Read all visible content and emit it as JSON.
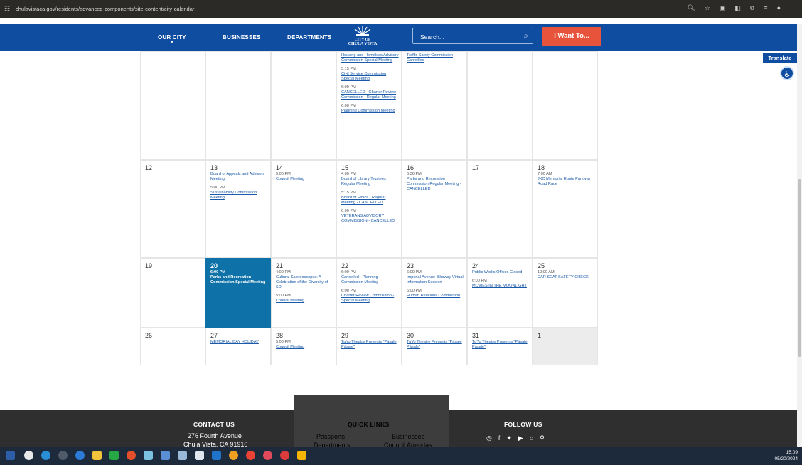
{
  "browser": {
    "url": "chulavistaca.gov/residents/advanced-components/site-content/city-calendar"
  },
  "nav": {
    "our_city": "OUR CITY",
    "businesses": "BUSINESSES",
    "departments": "DEPARTMENTS",
    "logo_line1": "CITY OF",
    "logo_line2": "CHULA VISTA",
    "search_placeholder": "Search...",
    "i_want_to": "I Want To..."
  },
  "translate_label": "Translate",
  "calendar": {
    "first_row": [
      {
        "day": "",
        "events": []
      },
      {
        "day": "",
        "events": []
      },
      {
        "day": "",
        "events": []
      },
      {
        "day": "",
        "events": [
          {
            "time": "",
            "title": "Housing and Homeless Advisory Commission Special Meeting"
          },
          {
            "time": "5:15 PM",
            "title": "Civil Service Commission Special Meeting"
          },
          {
            "time": "6:00 PM",
            "title": "CANCELLED - Charter Review Commission - Regular Meeting"
          },
          {
            "time": "6:00 PM",
            "title": "Planning Commission Meeting"
          }
        ]
      },
      {
        "day": "",
        "events": [
          {
            "time": "",
            "title": "Traffic Safety Commission Cancelled"
          }
        ]
      },
      {
        "day": "",
        "events": []
      },
      {
        "day": "",
        "events": []
      }
    ],
    "week2": [
      {
        "day": "12",
        "events": []
      },
      {
        "day": "13",
        "events": [
          {
            "time": "",
            "title": "Board of Appeals and Advisors Meeting"
          },
          {
            "time": "5:00 PM",
            "title": "Sustainability Commission Meeting"
          }
        ]
      },
      {
        "day": "14",
        "events": [
          {
            "time": "5:00 PM",
            "title": "Council Meeting"
          }
        ]
      },
      {
        "day": "15",
        "events": [
          {
            "time": "4:00 PM",
            "title": "Board of Library Trustees Regular Meeting"
          },
          {
            "time": "5:15 PM",
            "title": "Board of Ethics - Regular Meeting - CANCELLED"
          },
          {
            "time": "6:00 PM",
            "title": "VETERANS ADVISORY COMMISSION - CANCELLED"
          }
        ]
      },
      {
        "day": "16",
        "events": [
          {
            "time": "6:30 PM",
            "title": "Parks and Recreation Commission Regular Meeting - CANCELLED"
          }
        ]
      },
      {
        "day": "17",
        "events": []
      },
      {
        "day": "18",
        "events": [
          {
            "time": "7:00 AM",
            "title": "JKC Memorial Hunte Parkway Road Race"
          }
        ]
      }
    ],
    "week3": [
      {
        "day": "19",
        "events": []
      },
      {
        "day": "20",
        "events": [
          {
            "time": "6:00 PM",
            "title": "Parks and Recreation Commission Special Meeting"
          }
        ]
      },
      {
        "day": "21",
        "events": [
          {
            "time": "4:00 PM",
            "title": "Cultural Kaleidoscopes: A Celebration of the Diversity of SD"
          },
          {
            "time": "5:00 PM",
            "title": "Council Meeting"
          }
        ]
      },
      {
        "day": "22",
        "events": [
          {
            "time": "6:00 PM",
            "title": "Cancelled - Planning Commission Meeting"
          },
          {
            "time": "6:00 PM",
            "title": "Charter Review Commission - Special Meeting"
          }
        ]
      },
      {
        "day": "23",
        "events": [
          {
            "time": "6:00 PM",
            "title": "Imperial Avenue Bikeway Virtual Information Session"
          },
          {
            "time": "6:00 PM",
            "title": "Human Relations Commission"
          }
        ]
      },
      {
        "day": "24",
        "events": [
          {
            "time": "",
            "title": "Public Works Offices Closed"
          },
          {
            "time": "6:00 PM",
            "title": "MOVIES IN THE MOONLIGHT"
          }
        ]
      },
      {
        "day": "25",
        "events": [
          {
            "time": "10:00 AM",
            "title": "CAR SEAT SAFETY CHECK"
          }
        ]
      }
    ],
    "week4": [
      {
        "day": "26",
        "events": []
      },
      {
        "day": "27",
        "events": [
          {
            "time": "",
            "title": "MEMORIAL DAY HOLIDAY"
          }
        ]
      },
      {
        "day": "28",
        "events": [
          {
            "time": "5:00 PM",
            "title": "Council Meeting"
          }
        ]
      },
      {
        "day": "29",
        "events": [
          {
            "time": "",
            "title": "TuYo Theatre Presents \"Pásale Pásale\""
          }
        ]
      },
      {
        "day": "30",
        "events": [
          {
            "time": "",
            "title": "TuYo Theatre Presents \"Pásale Pásale\""
          }
        ]
      },
      {
        "day": "31",
        "events": [
          {
            "time": "",
            "title": "TuYo Theatre Presents \"Pásale Pásale\""
          }
        ]
      },
      {
        "day": "1",
        "events": []
      }
    ]
  },
  "footer": {
    "contact_heading": "CONTACT US",
    "address_line1": "276 Fourth Avenue",
    "address_line2": "Chula Vista, CA 91910",
    "quick_heading": "QUICK LINKS",
    "quick_links": [
      "Passports",
      "Businesses",
      "Departments",
      "Council Agendas"
    ],
    "follow_heading": "FOLLOW US"
  },
  "taskbar": {
    "time": "15:09",
    "date": "05/20/2024"
  },
  "colors": {
    "nav_blue": "#0f4da1",
    "today_blue": "#0e72a8",
    "orange": "#e8543b",
    "link": "#1a5aa8"
  }
}
